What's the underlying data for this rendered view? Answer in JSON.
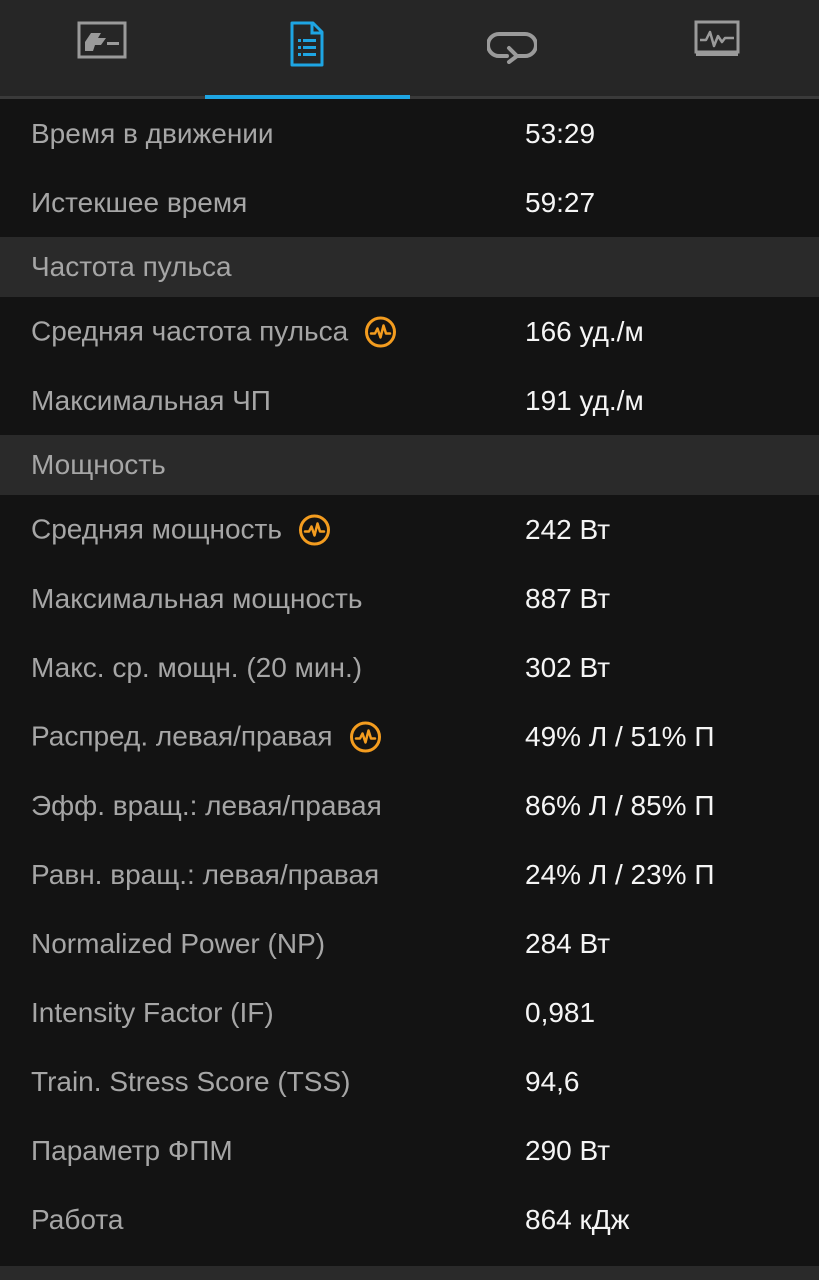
{
  "tabs": [
    {
      "icon": "map-icon",
      "active": false
    },
    {
      "icon": "summary-list-icon",
      "active": true
    },
    {
      "icon": "laps-icon",
      "active": false
    },
    {
      "icon": "chart-icon",
      "active": false
    }
  ],
  "colors": {
    "accent": "#1ea5e3",
    "badge": "#f39c1f",
    "background": "#131313",
    "section_bg": "#2a2a2a"
  },
  "timing": {
    "moving_time": {
      "label": "Время в движении",
      "value": "53:29"
    },
    "elapsed_time": {
      "label": "Истекшее время",
      "value": "59:27"
    }
  },
  "heart_rate": {
    "title": "Частота пульса",
    "avg": {
      "label": "Средняя частота пульса",
      "value": "166 уд./м"
    },
    "max": {
      "label": "Максимальная ЧП",
      "value": "191 уд./м"
    }
  },
  "power": {
    "title": "Мощность",
    "avg": {
      "label": "Средняя мощность",
      "value": "242 Вт"
    },
    "max": {
      "label": "Максимальная мощность",
      "value": "887 Вт"
    },
    "max_avg_20": {
      "label": "Макс. ср. мощн. (20 мин.)",
      "value": "302 Вт"
    },
    "balance": {
      "label": "Распред. левая/правая",
      "value": "49% Л / 51% П"
    },
    "torque_eff": {
      "label": "Эфф. вращ.: левая/правая",
      "value": "86% Л / 85% П"
    },
    "smoothness": {
      "label": "Равн. вращ.: левая/правая",
      "value": "24% Л / 23% П"
    },
    "np": {
      "label": "Normalized Power (NP)",
      "value": "284 Вт"
    },
    "if": {
      "label": "Intensity Factor (IF)",
      "value": "0,981"
    },
    "tss": {
      "label": "Train. Stress Score (TSS)",
      "value": "94,6"
    },
    "ftp": {
      "label": "Параметр ФПМ",
      "value": "290 Вт"
    },
    "work": {
      "label": "Работа",
      "value": "864 кДж"
    }
  }
}
